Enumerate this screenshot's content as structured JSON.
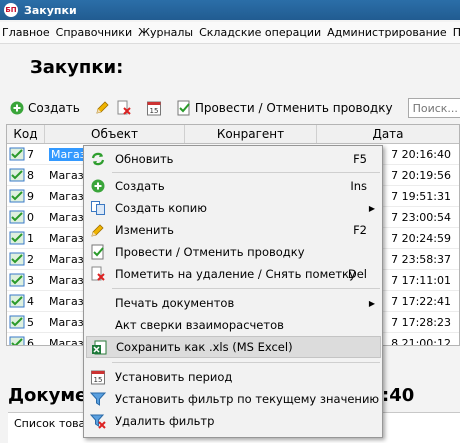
{
  "window": {
    "title": "Закупки",
    "app_icon_text": "БП"
  },
  "menu": [
    "Главное",
    "Справочники",
    "Журналы",
    "Складские операции",
    "Администрирование",
    "П"
  ],
  "page": {
    "title": "Закупки:"
  },
  "toolbar": {
    "create_label": "Создать",
    "post_label": "Провести / Отменить проводку",
    "search_placeholder": "Поиск..."
  },
  "table": {
    "headers": {
      "code": "Код",
      "object": "Объект",
      "kontragent": "Конрагент",
      "date": "Дата"
    },
    "rows": [
      {
        "code": "7",
        "object": "Магазин",
        "date": "7 20:16:40"
      },
      {
        "code": "8",
        "object": "Магазин",
        "date": "7 20:19:56"
      },
      {
        "code": "9",
        "object": "Магазин",
        "date": "7 19:51:31"
      },
      {
        "code": "0",
        "object": "Магазин",
        "date": "7 23:00:54"
      },
      {
        "code": "1",
        "object": "Магазин",
        "date": "7 20:24:59"
      },
      {
        "code": "2",
        "object": "Магазин",
        "date": "7 23:58:37"
      },
      {
        "code": "3",
        "object": "Магазин",
        "date": "7 17:11:01"
      },
      {
        "code": "4",
        "object": "Магазин",
        "date": "7 17:22:41"
      },
      {
        "code": "5",
        "object": "Магазин",
        "date": "7 17:28:23"
      },
      {
        "code": "6",
        "object": "Магазин",
        "date": "8 21:00:12"
      }
    ]
  },
  "bottom": {
    "title": "Докумен",
    "title_right": ":40",
    "tab_label": "Список товар"
  },
  "context_menu": {
    "refresh": {
      "label": "Обновить",
      "shortcut": "F5"
    },
    "create": {
      "label": "Создать",
      "shortcut": "Ins"
    },
    "copy": {
      "label": "Создать копию"
    },
    "edit": {
      "label": "Изменить",
      "shortcut": "F2"
    },
    "post": {
      "label": "Провести / Отменить проводку"
    },
    "mark_delete": {
      "label": "Пометить на удаление / Снять пометку",
      "shortcut": "Del"
    },
    "print": {
      "label": "Печать документов"
    },
    "act": {
      "label": "Акт сверки взаиморасчетов"
    },
    "save_xls": {
      "label": "Сохранить как .xls (MS Excel)"
    },
    "set_period": {
      "label": "Установить период"
    },
    "set_filter": {
      "label": "Установить фильтр по текущему значению"
    },
    "remove_filter": {
      "label": "Удалить фильтр"
    }
  },
  "colors": {
    "title_bar": "#215c91",
    "selection": "#3399ff",
    "menu_highlight": "#dcdcdc"
  }
}
